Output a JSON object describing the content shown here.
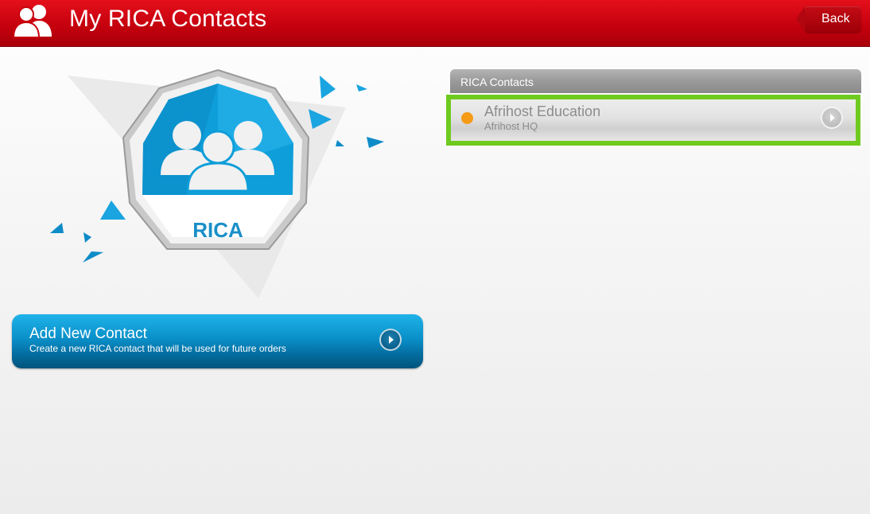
{
  "header": {
    "title": "My RICA Contacts",
    "icon": "contacts-icon",
    "back_label": "Back",
    "color": "#d10a15"
  },
  "badge": {
    "label": "RICA",
    "icon": "group-icon",
    "color": "#0d9fd8"
  },
  "add_contact": {
    "title": "Add New Contact",
    "subtitle": "Create a new RICA contact that will be used for future orders",
    "icon": "chevron-right-icon"
  },
  "contacts": {
    "header": "RICA Contacts",
    "items": [
      {
        "name": "Afrihost Education",
        "subtitle": "Afrihost HQ",
        "status_color": "#f59b16",
        "selected": true,
        "icon": "chevron-right-icon"
      }
    ],
    "selection_color": "#6fca1f"
  }
}
